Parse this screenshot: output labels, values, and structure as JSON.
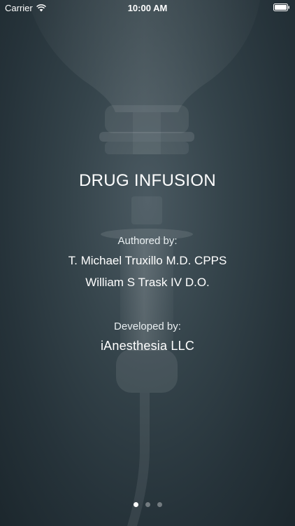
{
  "status_bar": {
    "carrier": "Carrier",
    "time": "10:00 AM",
    "icons": [
      "wifi-icon",
      "battery-icon"
    ]
  },
  "splash": {
    "title": "DRUG INFUSION",
    "authored_label": "Authored by:",
    "authors": [
      "T. Michael Truxillo M.D. CPPS",
      "William S Trask IV D.O."
    ],
    "developed_label": "Developed by:",
    "developer": "iAnesthesia LLC"
  },
  "pager": {
    "total_pages": 3,
    "current_page": 1
  },
  "colors": {
    "background": "#2f3d44",
    "text": "#ffffff",
    "dot_active": "#ffffff",
    "dot_inactive": "#7f8a8f"
  }
}
